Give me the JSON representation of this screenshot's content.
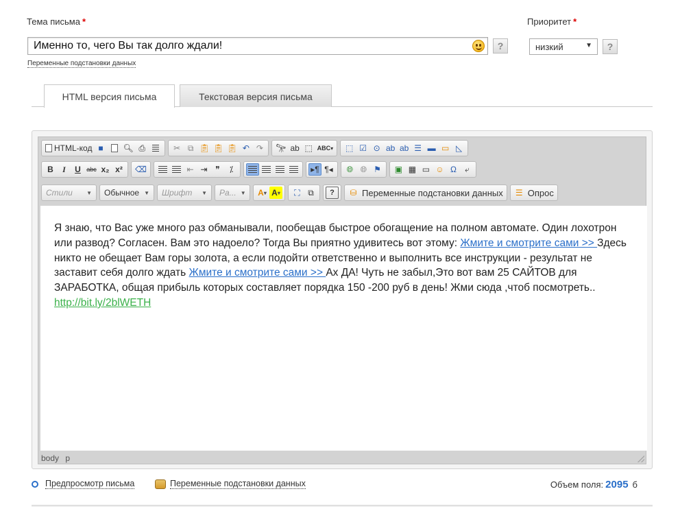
{
  "form": {
    "subject_label": "Тема письма",
    "required_mark": "*",
    "subject_value": "Именно то, чего Вы так долго ждали!",
    "help_label": "?",
    "vars_link_small": "Переменные подстановки данных",
    "priority_label": "Приоритет",
    "priority_value": "низкий",
    "priority_arrow": "▼"
  },
  "tabs": [
    {
      "label": "HTML версия письма",
      "active": true
    },
    {
      "label": "Текстовая версия письма",
      "active": false
    }
  ],
  "toolbar": {
    "html_code_label": "HTML-код",
    "styles_label": "Стили",
    "format_label": "Обычное",
    "font_label": "Шрифт",
    "size_label": "Ра...",
    "vars_button_label": "Переменные подстановки данных",
    "poll_button_label": "Опрос",
    "bold": "B",
    "italic": "I",
    "underline": "U",
    "strike": "abc",
    "subscript": "x₂",
    "superscript": "x²",
    "spell": "ABC",
    "omega": "Ω",
    "help": "?"
  },
  "content": {
    "p1": " Я знаю, что Вас уже много раз обманывали, пообещав быстрое обогащение на полном автомате. Один лохотрон или развод? Согласен. Вам это надоело? Тогда Вы приятно удивитесь вот этому: ",
    "link1": "Жмите и смотрите сами >> ",
    "p2": " Здесь никто не обещает Вам горы золота, а если подойти ответственно и выполнить все инструкции - результат не заставит себя долго ждать ",
    "link2": "Жмите и смотрите сами >> ",
    "p3": " Ах ДА! Чуть не забыл,Это вот вам 25 САЙТОВ для ЗАРАБОТКА, общая прибыль которых составляет порядка 150 -200 руб в день! Жми сюда ,чтоб посмотреть.. ",
    "link3": "http://bit.ly/2blWETH"
  },
  "statusbar": [
    "body",
    "p"
  ],
  "footer": {
    "preview_link": "Предпросмотр письма",
    "vars_link": "Переменные подстановки данных",
    "size_label": "Объем поля:",
    "size_value": "2095",
    "size_unit": "б"
  },
  "colors": {
    "required": "#d00",
    "link": "#2a6fc9",
    "green_link": "#3bb14a",
    "toolbar_active": "#8fb4e8"
  }
}
